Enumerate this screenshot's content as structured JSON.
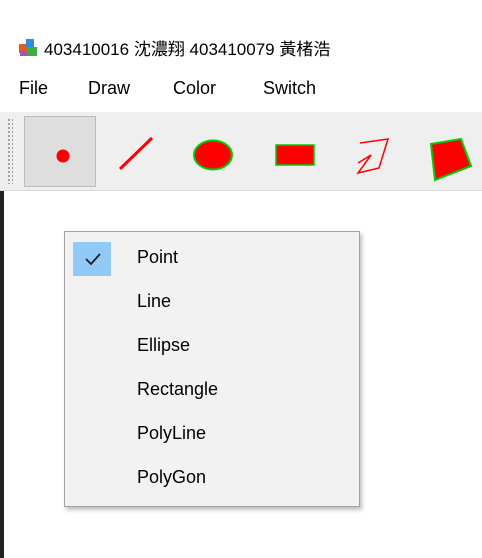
{
  "title": "403410016 沈濃翔 403410079 黃楮浩",
  "menu": {
    "file": "File",
    "draw": "Draw",
    "color": "Color",
    "switch": "Switch"
  },
  "toolbar": {
    "tools": [
      {
        "name": "point",
        "icon": "point-icon",
        "active": true
      },
      {
        "name": "line",
        "icon": "line-icon",
        "active": false
      },
      {
        "name": "ellipse",
        "icon": "ellipse-icon",
        "active": false
      },
      {
        "name": "rectangle",
        "icon": "rectangle-icon",
        "active": false
      },
      {
        "name": "polyline",
        "icon": "polyline-icon",
        "active": false
      },
      {
        "name": "polygon",
        "icon": "polygon-icon",
        "active": false
      }
    ],
    "colors": {
      "shape": "#ff0000",
      "outline": "#00cc00"
    }
  },
  "context_menu": {
    "items": [
      {
        "label": "Point",
        "checked": true
      },
      {
        "label": "Line",
        "checked": false
      },
      {
        "label": "Ellipse",
        "checked": false
      },
      {
        "label": "Rectangle",
        "checked": false
      },
      {
        "label": "PolyLine",
        "checked": false
      },
      {
        "label": "PolyGon",
        "checked": false
      }
    ],
    "highlight_color": "#91c9f7"
  }
}
